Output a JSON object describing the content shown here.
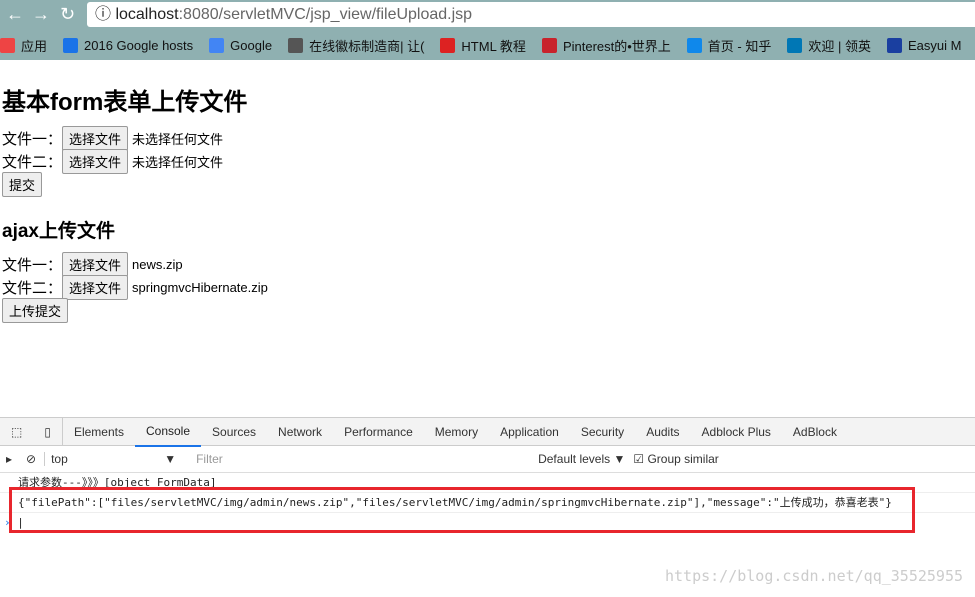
{
  "browser": {
    "url_host": "localhost",
    "url_rest": ":8080/servletMVC/jsp_view/fileUpload.jsp",
    "bookmarks": [
      {
        "label": "应用",
        "color": "#e44"
      },
      {
        "label": "2016 Google hosts",
        "color": "#1a73e8"
      },
      {
        "label": "Google",
        "color": "#4285f4"
      },
      {
        "label": "在线徽标制造商| 让(",
        "color": "#555"
      },
      {
        "label": "HTML 教程",
        "color": "#d22"
      },
      {
        "label": "Pinterest的•世界上",
        "color": "#c8232c"
      },
      {
        "label": "首页 - 知乎",
        "color": "#0f88eb"
      },
      {
        "label": "欢迎 | 领英",
        "color": "#0077b5"
      },
      {
        "label": "Easyui M",
        "color": "#1a3fa0"
      }
    ]
  },
  "form": {
    "title": "基本form表单上传文件",
    "file1_label": "文件一：",
    "file2_label": "文件二：",
    "choose": "选择文件",
    "file1_value": "未选择任何文件",
    "file2_value": "未选择任何文件",
    "submit": "提交"
  },
  "ajax": {
    "title": "ajax上传文件",
    "file1_label": "文件一：",
    "file2_label": "文件二：",
    "choose": "选择文件",
    "file1_value": "news.zip",
    "file2_value": "springmvcHibernate.zip",
    "submit": "上传提交"
  },
  "devtools": {
    "tabs": [
      "Elements",
      "Console",
      "Sources",
      "Network",
      "Performance",
      "Memory",
      "Application",
      "Security",
      "Audits",
      "Adblock Plus",
      "AdBlock"
    ],
    "context": "top",
    "filter_placeholder": "Filter",
    "levels": "Default levels ▼",
    "group_similar": "Group similar",
    "logs": [
      "请求参数---》》》[object FormData]",
      "{\"filePath\":[\"files/servletMVC/img/admin/news.zip\",\"files/servletMVC/img/admin/springmvcHibernate.zip\"],\"message\":\"上传成功，恭喜老表\"}"
    ]
  },
  "watermark": "https://blog.csdn.net/qq_35525955"
}
